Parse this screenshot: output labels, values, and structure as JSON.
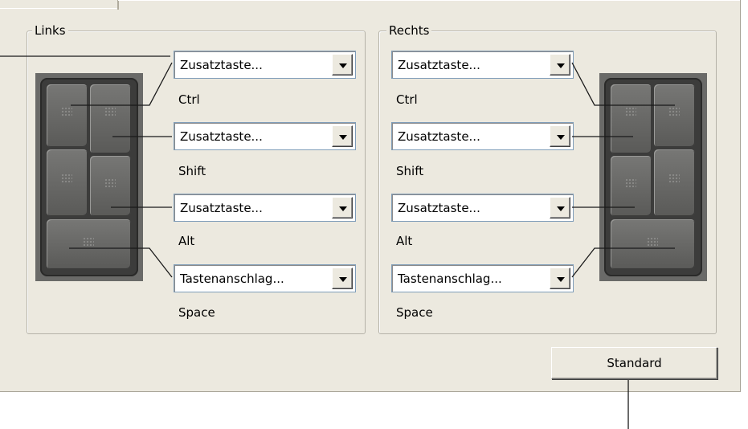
{
  "groups": {
    "left": {
      "title": "Links",
      "rows": [
        {
          "value": "Zusatztaste...",
          "caption": "Ctrl"
        },
        {
          "value": "Zusatztaste...",
          "caption": "Shift"
        },
        {
          "value": "Zusatztaste...",
          "caption": "Alt"
        },
        {
          "value": "Tastenanschlag...",
          "caption": "Space"
        }
      ]
    },
    "right": {
      "title": "Rechts",
      "rows": [
        {
          "value": "Zusatztaste...",
          "caption": "Ctrl"
        },
        {
          "value": "Zusatztaste...",
          "caption": "Shift"
        },
        {
          "value": "Zusatztaste...",
          "caption": "Alt"
        },
        {
          "value": "Tastenanschlag...",
          "caption": "Space"
        }
      ]
    }
  },
  "standard_button": "Standard",
  "icons": {
    "dropdown": "chevron-down-icon",
    "device": "express-keys-device"
  }
}
